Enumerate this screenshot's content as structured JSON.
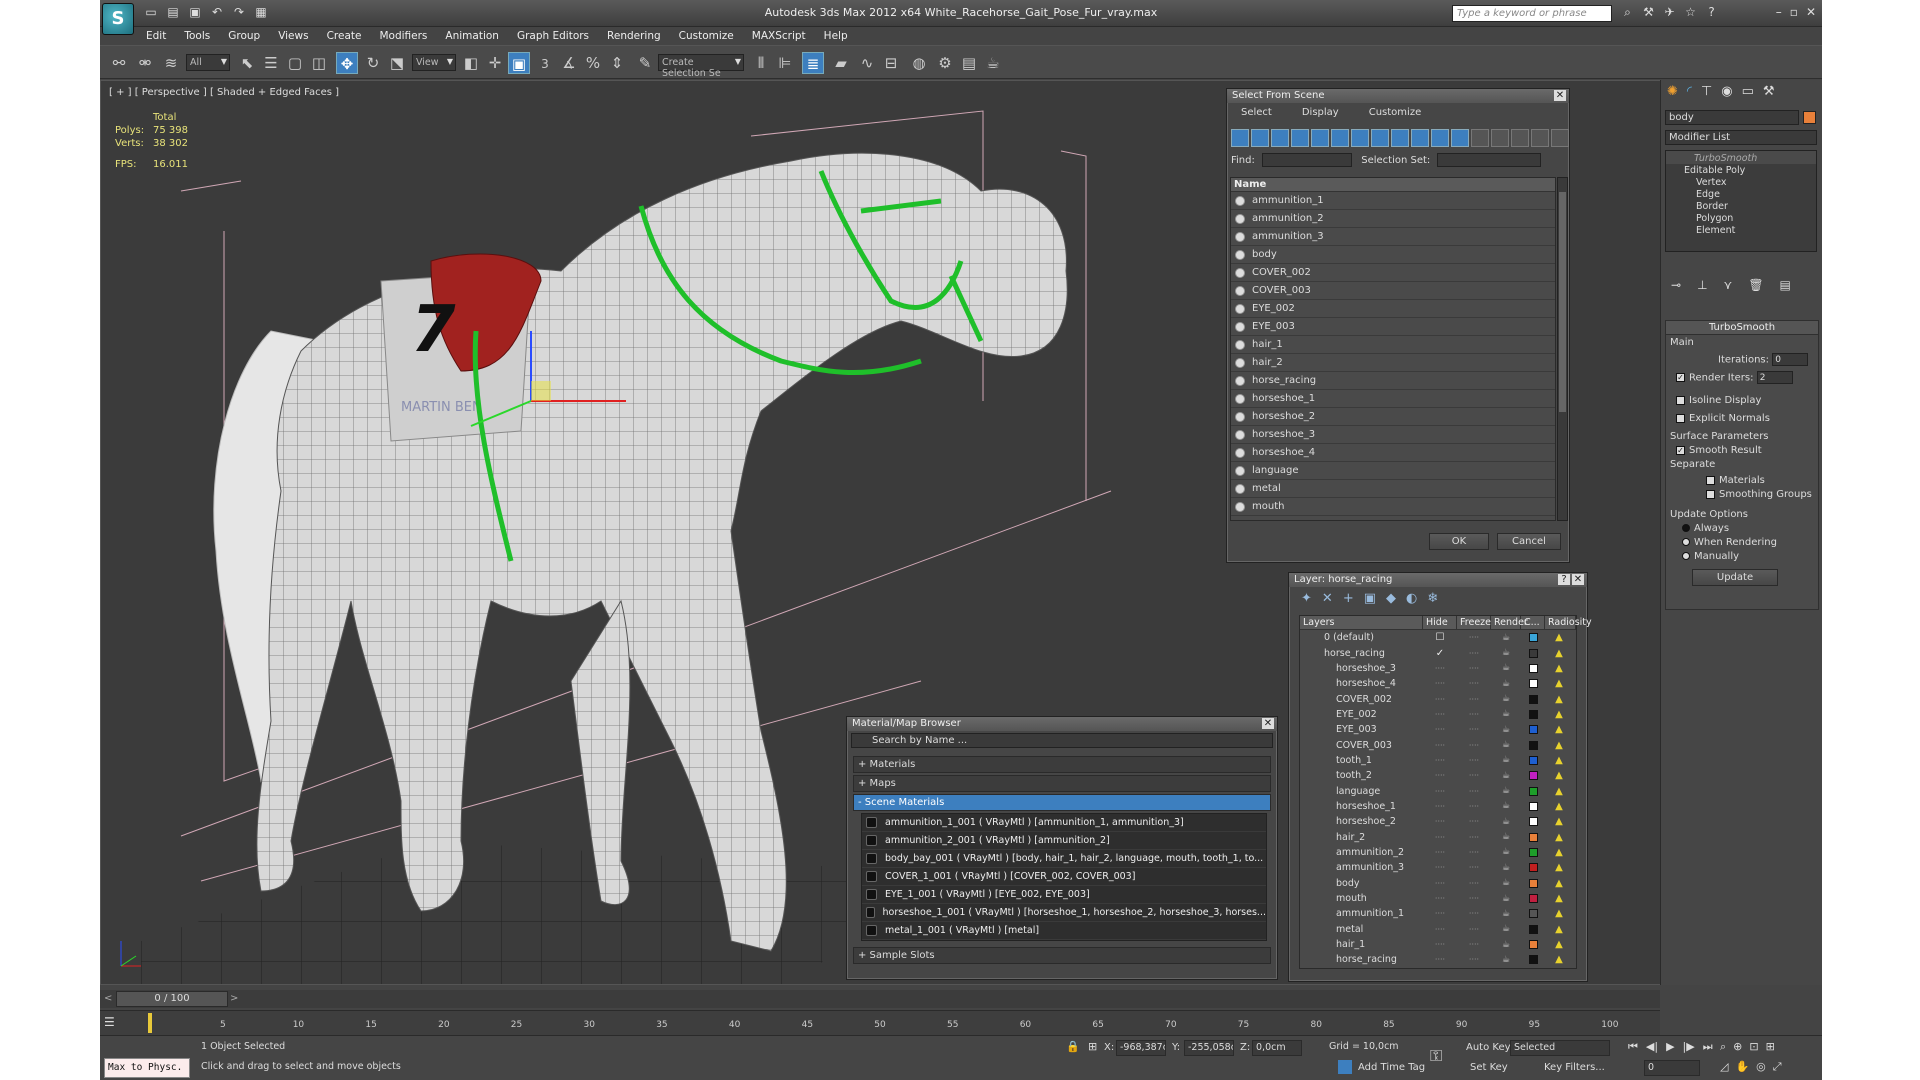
{
  "app": {
    "logo": "S",
    "title": "Autodesk 3ds Max  2012 x64     White_Racehorse_Gait_Pose_Fur_vray.max",
    "search_placeholder": "Type a keyword or phrase"
  },
  "menu": [
    "Edit",
    "Tools",
    "Group",
    "Views",
    "Create",
    "Modifiers",
    "Animation",
    "Graph Editors",
    "Rendering",
    "Customize",
    "MAXScript",
    "Help"
  ],
  "toolbar": {
    "filter": "All",
    "refcoord": "View",
    "selection_set": "Create Selection Se",
    "snap_label": "3"
  },
  "viewport": {
    "label": "[ + ] [ Perspective ] [ Shaded + Edged Faces ]",
    "stats": {
      "total_label": "Total",
      "polys_label": "Polys:",
      "polys": "75 398",
      "verts_label": "Verts:",
      "verts": "38 302",
      "fps_label": "FPS:",
      "fps": "16.011"
    },
    "saddlecloth_number": "7",
    "saddlecloth_text": "MARTIN BEN"
  },
  "select_from_scene": {
    "title": "Select From Scene",
    "menu": [
      "Select",
      "Display",
      "Customize"
    ],
    "find_label": "Find:",
    "selection_set_label": "Selection Set:",
    "column": "Name",
    "items": [
      "ammunition_1",
      "ammunition_2",
      "ammunition_3",
      "body",
      "COVER_002",
      "COVER_003",
      "EYE_002",
      "EYE_003",
      "hair_1",
      "hair_2",
      "horse_racing",
      "horseshoe_1",
      "horseshoe_2",
      "horseshoe_3",
      "horseshoe_4",
      "language",
      "metal",
      "mouth"
    ],
    "ok": "OK",
    "cancel": "Cancel"
  },
  "layers": {
    "title": "Layer: horse_racing",
    "help": "?",
    "columns": [
      "Layers",
      "Hide",
      "Freeze",
      "Render",
      "C...",
      "Radiosity"
    ],
    "rows": [
      {
        "name": "0 (default)",
        "color": "#3aa5d8",
        "top": true,
        "mark": "☐"
      },
      {
        "name": "horse_racing",
        "color": "#3a3a3a",
        "top": true,
        "mark": "✓"
      },
      {
        "name": "horseshoe_3",
        "color": "#ffffff"
      },
      {
        "name": "horseshoe_4",
        "color": "#ffffff"
      },
      {
        "name": "COVER_002",
        "color": "#111111"
      },
      {
        "name": "EYE_002",
        "color": "#111111"
      },
      {
        "name": "EYE_003",
        "color": "#1e5fd0"
      },
      {
        "name": "COVER_003",
        "color": "#111111"
      },
      {
        "name": "tooth_1",
        "color": "#1e5fd0"
      },
      {
        "name": "tooth_2",
        "color": "#c020c0"
      },
      {
        "name": "language",
        "color": "#1e9e2a"
      },
      {
        "name": "horseshoe_1",
        "color": "#ffffff"
      },
      {
        "name": "horseshoe_2",
        "color": "#ffffff"
      },
      {
        "name": "hair_2",
        "color": "#e8803a"
      },
      {
        "name": "ammunition_2",
        "color": "#1e9e2a"
      },
      {
        "name": "ammunition_3",
        "color": "#c02020"
      },
      {
        "name": "body",
        "color": "#e8803a"
      },
      {
        "name": "mouth",
        "color": "#c02040"
      },
      {
        "name": "ammunition_1",
        "color": "#555555"
      },
      {
        "name": "metal",
        "color": "#111111"
      },
      {
        "name": "hair_1",
        "color": "#e8803a"
      },
      {
        "name": "horse_racing",
        "color": "#111111"
      }
    ]
  },
  "material_browser": {
    "title": "Material/Map Browser",
    "search": "Search by Name ...",
    "groups": {
      "materials": "+ Materials",
      "maps": "+ Maps",
      "scene": "- Scene Materials",
      "sample": "+ Sample Slots"
    },
    "items": [
      "ammunition_1_001  ( VRayMtl ) [ammunition_1, ammunition_3]",
      "ammunition_2_001  ( VRayMtl ) [ammunition_2]",
      "body_bay_001  ( VRayMtl ) [body, hair_1, hair_2, language, mouth, tooth_1, to...",
      "COVER_1_001  ( VRayMtl ) [COVER_002, COVER_003]",
      "EYE_1_001  ( VRayMtl ) [EYE_002, EYE_003]",
      "horseshoe_1_001  ( VRayMtl ) [horseshoe_1, horseshoe_2, horseshoe_3, horses...",
      "metal_1_001  ( VRayMtl ) [metal]"
    ]
  },
  "command_panel": {
    "object_name": "body",
    "object_color": "#e8803a",
    "modifier_list": "Modifier List",
    "stack": [
      "TurboSmooth",
      "Editable Poly",
      "Vertex",
      "Edge",
      "Border",
      "Polygon",
      "Element"
    ],
    "turbosmooth": {
      "title": "TurboSmooth",
      "main": "Main",
      "iterations_label": "Iterations:",
      "iterations": "0",
      "render_iters_label": "Render Iters:",
      "render_iters": "2",
      "isoline": "Isoline Display",
      "explicit": "Explicit Normals",
      "surface": "Surface Parameters",
      "smooth_result": "Smooth Result",
      "separate": "Separate",
      "materials": "Materials",
      "smoothing_groups": "Smoothing Groups",
      "update_options": "Update Options",
      "always": "Always",
      "when_rendering": "When Rendering",
      "manually": "Manually",
      "update": "Update"
    }
  },
  "timeline": {
    "frame": "0 / 100",
    "ticks": [
      "5",
      "10",
      "15",
      "20",
      "25",
      "30",
      "35",
      "40",
      "45",
      "50",
      "55",
      "60",
      "65",
      "70",
      "75",
      "80",
      "85",
      "90",
      "95",
      "100"
    ]
  },
  "status": {
    "maxscript": "Max to Physc.",
    "selected": "1 Object Selected",
    "prompt": "Click and drag to select and move objects",
    "x_label": "X:",
    "x": "-968,387cr",
    "y_label": "Y:",
    "y": "-255,058cr",
    "z_label": "Z:",
    "z": "0,0cm",
    "grid": "Grid = 10,0cm",
    "autokey": "Auto Key",
    "selected_dd": "Selected",
    "setkey": "Set Key",
    "keyfilters": "Key Filters...",
    "add_time_tag": "Add Time Tag",
    "frame_field": "0"
  }
}
